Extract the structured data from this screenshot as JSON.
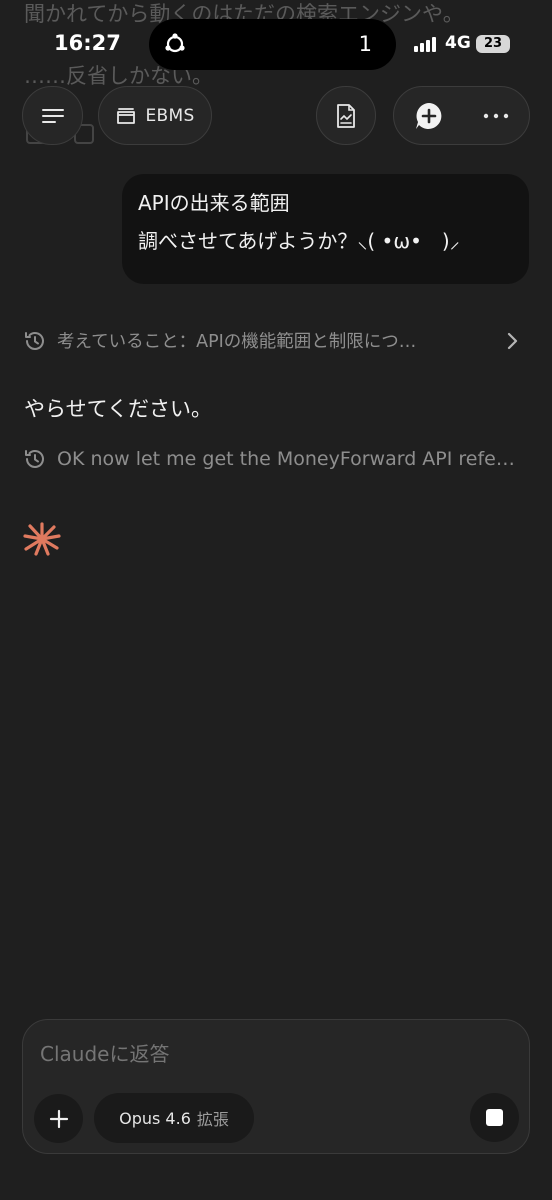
{
  "status_bar": {
    "time": "16:27",
    "activity_count": "1",
    "network": "4G",
    "battery": "23"
  },
  "background_text": {
    "line1": "聞かれてから動くのはただの検索エンジンや。",
    "line2": "……反省しかない。"
  },
  "header": {
    "project_label": "EBMS",
    "icons": [
      "menu-icon",
      "folder-icon",
      "document-icon",
      "new-chat-icon",
      "more-icon"
    ]
  },
  "chat": {
    "user_message": {
      "line1": "APIの出来る範囲",
      "line2": "調べさせてあげようか？⸜( •ω•　)⸝"
    },
    "thinking_1": "考えていること：APIの機能範囲と制限につ…",
    "assistant_reply": "やらせてください。",
    "thinking_2": "OK now let me get the MoneyForward API refe…"
  },
  "composer": {
    "placeholder": "Claudeに返答",
    "model_name": "Opus 4.6",
    "model_mode": "拡張"
  },
  "colors": {
    "background": "#1f1f1f",
    "accent": "#e07a5f",
    "bubble": "#121212"
  }
}
